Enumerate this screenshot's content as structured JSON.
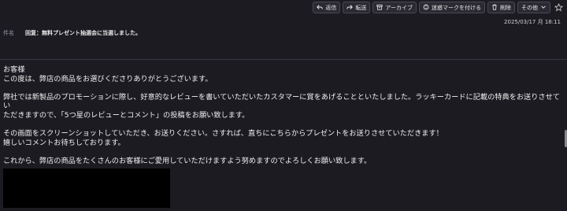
{
  "toolbar": {
    "reply": "返信",
    "forward": "転送",
    "archive": "アーカイブ",
    "junk": "迷惑マークを付ける",
    "delete": "削除",
    "more": "その他"
  },
  "message": {
    "date": "2025/03/17 月 18:11",
    "subject_label": "件名",
    "subject": "回复：無料プレゼント抽選会に当選しました。",
    "lines": [
      "お客様",
      "この度は、弊店の商品をお選びくださりありがとうございます。",
      "",
      "弊社では新製品のプロモーションに際し、好意的なレビューを書いていただいたカスタマーに賞をあげることといたしました。ラッキーカードに記載の特典をお送りさせてい",
      "ただきますので、「5つ星のレビューとコメント」の投稿をお願い致します。",
      "",
      "その画面をスクリーンショットしていただき、お送りください。さすれば、直ちにこちらからプレゼントをお送りさせていただきます！",
      "嬉しいコメントお待ちしております。",
      "",
      "これから、弊店の商品をたくさんのお客様にご愛用していただけますよう努めますのでよろしくお願い致します。"
    ]
  },
  "icons": {
    "reply": "reply-icon",
    "forward": "forward-icon",
    "archive": "archive-icon",
    "junk": "junk-icon",
    "delete": "trash-icon",
    "more": "chevron-down-icon",
    "star": "star-icon"
  }
}
